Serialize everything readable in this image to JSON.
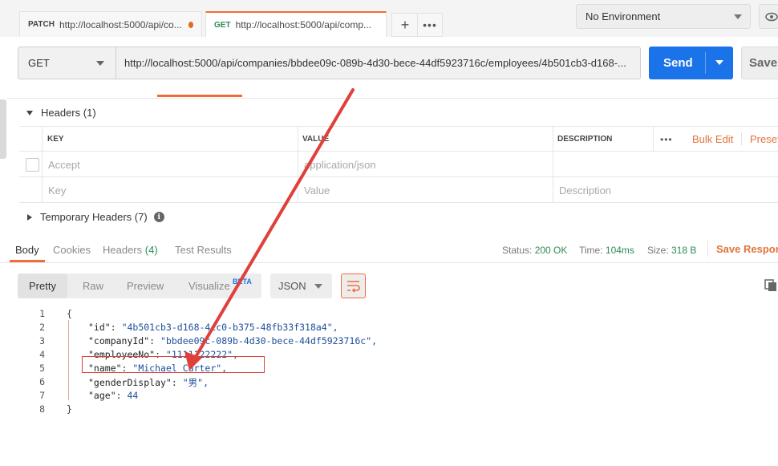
{
  "tabs": [
    {
      "method": "PATCH",
      "url": "http://localhost:5000/api/co..."
    },
    {
      "method": "GET",
      "url": "http://localhost:5000/api/comp..."
    }
  ],
  "tab_controls": {
    "plus": "+",
    "more": "•••"
  },
  "environment": {
    "selected": "No Environment"
  },
  "request": {
    "method": "GET",
    "url": "http://localhost:5000/api/companies/bbdee09c-089b-4d30-bece-44df5923716c/employees/4b501cb3-d168-...",
    "send_label": "Send",
    "save_label": "Save"
  },
  "headers_section": {
    "title": "Headers",
    "count": "(1)",
    "columns": {
      "key": "KEY",
      "value": "VALUE",
      "description": "DESCRIPTION"
    },
    "more": "•••",
    "bulk_edit": "Bulk Edit",
    "presets": "Preset",
    "rows": [
      {
        "key": "Accept",
        "value": "application/json",
        "description": ""
      }
    ],
    "placeholders": {
      "key": "Key",
      "value": "Value",
      "description": "Description"
    }
  },
  "temporary_headers": {
    "title": "Temporary Headers",
    "count": "(7)",
    "icon": "info-icon"
  },
  "response": {
    "tabs": {
      "body": "Body",
      "cookies": "Cookies",
      "headers": "Headers",
      "headers_count": "(4)",
      "tests": "Test Results"
    },
    "status_label": "Status:",
    "status_value": "200 OK",
    "time_label": "Time:",
    "time_value": "104ms",
    "size_label": "Size:",
    "size_value": "318 B",
    "save_response": "Save Respon",
    "views": {
      "pretty": "Pretty",
      "raw": "Raw",
      "preview": "Preview",
      "visualize": "Visualize",
      "beta": "BETA"
    },
    "format": "JSON",
    "lines": [
      {
        "n": "1",
        "text": "{"
      },
      {
        "n": "2",
        "key": "\"id\"",
        "val": "\"4b501cb3-d168-4cc0-b375-48fb33f318a4\","
      },
      {
        "n": "3",
        "key": "\"companyId\"",
        "val": "\"bbdee09c-089b-4d30-bece-44df5923716c\","
      },
      {
        "n": "4",
        "key": "\"employeeNo\"",
        "val": "\"1111122222\","
      },
      {
        "n": "5",
        "key": "\"name\"",
        "val": "\"Michael Carter\","
      },
      {
        "n": "6",
        "key": "\"genderDisplay\"",
        "val": "\"男\","
      },
      {
        "n": "7",
        "key": "\"age\"",
        "val": "44"
      },
      {
        "n": "8",
        "text": "}"
      }
    ]
  },
  "colors": {
    "accent": "#f26b3a",
    "send": "#1a73e8",
    "status_ok": "#2e8b57",
    "annotation": "#e0403a"
  }
}
